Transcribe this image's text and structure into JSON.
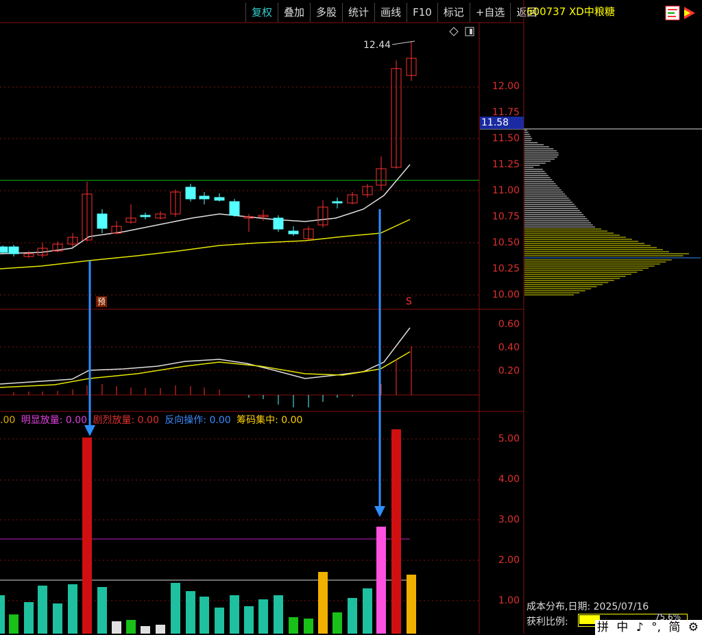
{
  "toolbar": {
    "buttons": [
      "复权",
      "叠加",
      "多股",
      "统计",
      "画线",
      "F10",
      "标记",
      "+自选",
      "返回"
    ]
  },
  "stock": {
    "code": "600737",
    "name": "XD中粮糖",
    "title": "600737 XD中粮糖"
  },
  "price_chart": {
    "high_label": "12.44",
    "current_price": "11.58",
    "y_ticks": [
      "12.00",
      "11.75",
      "11.50",
      "11.25",
      "11.00",
      "10.75",
      "10.50",
      "10.25",
      "10.00"
    ],
    "tag_yu": "预",
    "tag_s": "S"
  },
  "macd_panel": {
    "y_ticks": [
      "0.60",
      "0.40",
      "0.20"
    ]
  },
  "volume_panel": {
    "legend": [
      {
        "label": ".00",
        "color": "#e0b000"
      },
      {
        "label": "明显放量: 0.00",
        "color": "#e040e0"
      },
      {
        "label": "剧烈放量: 0.00",
        "color": "#e03030"
      },
      {
        "label": "反向操作: 0.00",
        "color": "#3a8cff"
      },
      {
        "label": "筹码集中: 0.00",
        "color": "#ffd000"
      }
    ],
    "y_ticks": [
      "5.00",
      "4.00",
      "3.00",
      "2.00",
      "1.00"
    ]
  },
  "cost_distribution": {
    "label": "成本分布,日期:",
    "date": "2025/07/16",
    "profit_label": "获利比例:",
    "profit_value": "75.6%"
  },
  "ime": {
    "items": [
      "拼",
      "中",
      "♪",
      "°,",
      "简",
      "⚙"
    ]
  },
  "colors": {
    "up": "#ff3030",
    "down": "#54ffff",
    "ma_white": "#e0e0e0",
    "ma_yellow": "#e6e600",
    "grid": "#8a1010"
  }
}
